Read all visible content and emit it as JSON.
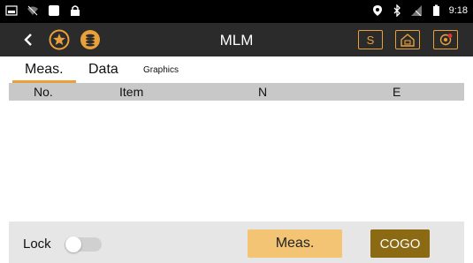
{
  "status_bar": {
    "time": "9:18",
    "left_icons": [
      "image-icon",
      "wifi-off-icon",
      "square-icon",
      "lock-icon"
    ],
    "right_icons": [
      "location-icon",
      "bluetooth-icon",
      "no-signal-icon",
      "battery-icon"
    ]
  },
  "app_bar": {
    "title": "MLM",
    "icons": [
      "back-icon",
      "star-icon",
      "coins-icon"
    ],
    "s_button_label": "S",
    "right_icons": [
      "home-setup-icon",
      "target-icon"
    ],
    "accent_color": "#e8a13a"
  },
  "tabs": [
    {
      "label": "Meas.",
      "active": true
    },
    {
      "label": "Data",
      "active": false
    },
    {
      "label": "Graphics",
      "active": false
    }
  ],
  "table": {
    "columns": [
      "No.",
      "Item",
      "N",
      "E"
    ],
    "rows": []
  },
  "bottom_bar": {
    "lock_label": "Lock",
    "lock_on": false,
    "meas_button": "Meas.",
    "cogo_button": "COGO"
  }
}
